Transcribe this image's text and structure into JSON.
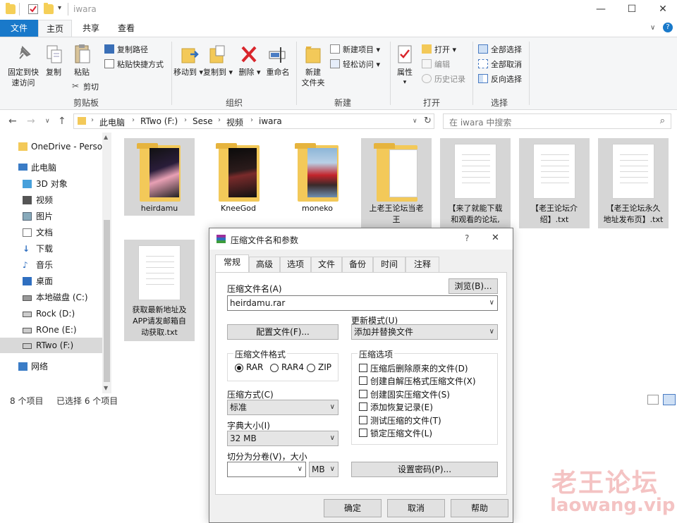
{
  "window": {
    "title": "iwara",
    "controls": {
      "minimize": "—",
      "maximize": "☐",
      "close": "✕"
    }
  },
  "ribbon_tabs": [
    "文件",
    "主页",
    "共享",
    "查看"
  ],
  "ribbon": {
    "clipboard": {
      "label": "剪贴板",
      "pin": "固定到快速访问",
      "pin_l1": "固定到快",
      "pin_l2": "速访问",
      "copy": "复制",
      "paste": "粘贴",
      "copy_path": "复制路径",
      "paste_shortcut": "粘贴快捷方式",
      "cut": "剪切"
    },
    "organize": {
      "label": "组织",
      "move_to": "移动到",
      "copy_to": "复制到",
      "delete": "删除",
      "rename": "重命名"
    },
    "new": {
      "label": "新建",
      "new_folder_l1": "新建",
      "new_folder_l2": "文件夹",
      "new_item": "新建项目",
      "easy_access": "轻松访问"
    },
    "open": {
      "label": "打开",
      "properties": "属性",
      "open": "打开",
      "edit": "编辑",
      "history": "历史记录"
    },
    "select": {
      "label": "选择",
      "select_all": "全部选择",
      "select_none": "全部取消",
      "invert": "反向选择"
    }
  },
  "address": {
    "crumbs": [
      "此电脑",
      "RTwo (F:)",
      "Sese",
      "视频",
      "iwara"
    ],
    "search_placeholder": "在 iwara 中搜索"
  },
  "sidebar": {
    "items": [
      {
        "label": "OneDrive - Personal",
        "icon": "onedrive-folder-icon"
      },
      {
        "label": "此电脑",
        "icon": "computer-icon"
      },
      {
        "label": "3D 对象",
        "icon": "3d-objects-icon"
      },
      {
        "label": "视频",
        "icon": "video-icon"
      },
      {
        "label": "图片",
        "icon": "pictures-icon"
      },
      {
        "label": "文档",
        "icon": "documents-icon"
      },
      {
        "label": "下载",
        "icon": "download-icon"
      },
      {
        "label": "音乐",
        "icon": "music-icon"
      },
      {
        "label": "桌面",
        "icon": "desktop-icon"
      },
      {
        "label": "本地磁盘 (C:)",
        "icon": "drive-icon"
      },
      {
        "label": "Rock (D:)",
        "icon": "drive-icon"
      },
      {
        "label": "ROne (E:)",
        "icon": "drive-icon"
      },
      {
        "label": "RTwo (F:)",
        "icon": "drive-icon"
      },
      {
        "label": "网络",
        "icon": "network-icon"
      }
    ]
  },
  "files": [
    {
      "name": "heirdamu",
      "type": "folder",
      "selected": true
    },
    {
      "name": "KneeGod",
      "type": "folder",
      "selected": false
    },
    {
      "name": "moneko",
      "type": "folder",
      "selected": false
    },
    {
      "name_l1": "上老王论坛当老",
      "name_l2": "王",
      "type": "folder",
      "selected": true
    },
    {
      "name_l1": "【来了就能下载",
      "name_l2": "和观看的论坛,",
      "type": "txt",
      "selected": true
    },
    {
      "name_l1": "【老王论坛介",
      "name_l2": "绍】.txt",
      "type": "txt",
      "selected": true
    },
    {
      "name_l1": "【老王论坛永久",
      "name_l2": "地址发布页】.txt",
      "type": "txt",
      "selected": true
    },
    {
      "name_l1": "获取最新地址及",
      "name_l2": "APP请发邮箱自",
      "name_l3": "动获取.txt",
      "type": "txt",
      "selected": true
    }
  ],
  "status": {
    "count": "8 个项目",
    "selected": "已选择 6 个项目"
  },
  "dialog": {
    "title": "压缩文件名和参数",
    "help": "?",
    "close": "✕",
    "tabs": [
      "常规",
      "高级",
      "选项",
      "文件",
      "备份",
      "时间",
      "注释"
    ],
    "archive_name_label": "压缩文件名(A)",
    "browse": "浏览(B)...",
    "archive_name": "heirdamu.rar",
    "profiles": "配置文件(F)...",
    "update_mode_label": "更新模式(U)",
    "update_mode": "添加并替换文件",
    "format_label": "压缩文件格式",
    "formats": [
      "RAR",
      "RAR4",
      "ZIP"
    ],
    "format_selected": "RAR",
    "method_label": "压缩方式(C)",
    "method": "标准",
    "dict_label": "字典大小(I)",
    "dict": "32 MB",
    "split_label": "切分为分卷(V)，大小",
    "split_value": "",
    "split_unit": "MB",
    "options_label": "压缩选项",
    "options": [
      "压缩后删除原来的文件(D)",
      "创建自解压格式压缩文件(X)",
      "创建固实压缩文件(S)",
      "添加恢复记录(E)",
      "测试压缩的文件(T)",
      "锁定压缩文件(L)"
    ],
    "password": "设置密码(P)...",
    "ok": "确定",
    "cancel": "取消",
    "help_btn": "帮助"
  },
  "watermark": {
    "line1": "老王论坛",
    "line2": "laowang.vip"
  },
  "colors": {
    "accent": "#1979ca",
    "selection": "#d6d6d6",
    "folder": "#f3c959",
    "watermark": "#f4c3c3"
  }
}
